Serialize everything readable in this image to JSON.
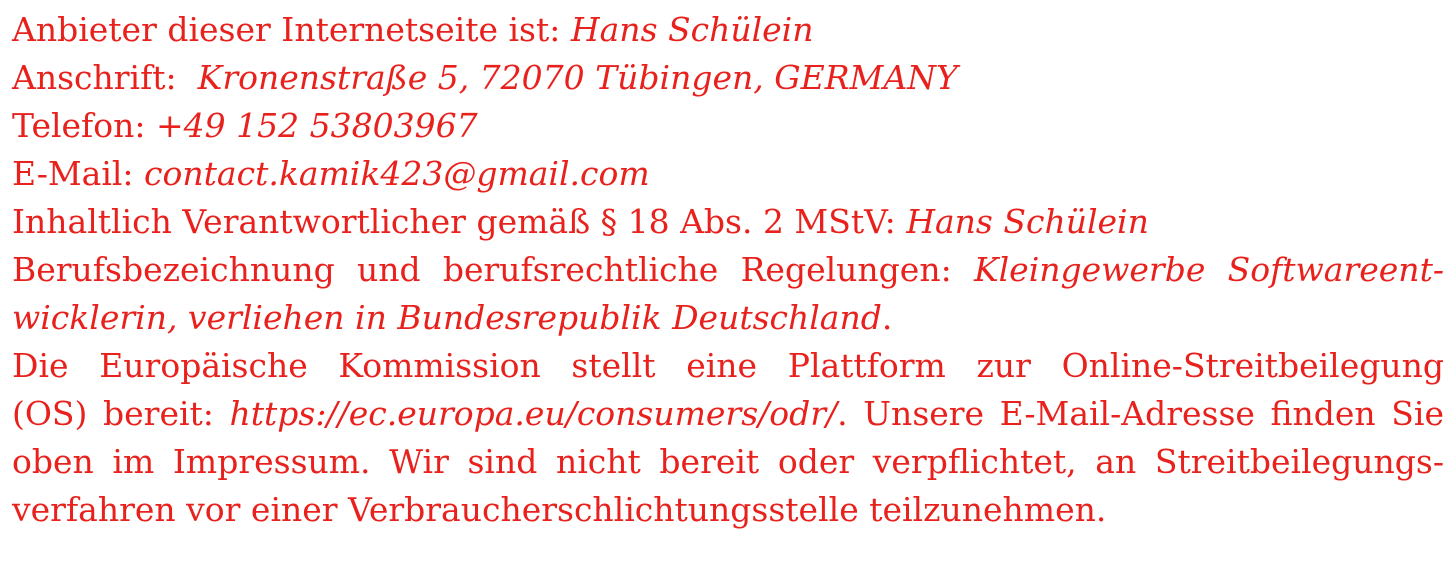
{
  "impressum": {
    "provider_label": "Anbieter dieser Internetseite ist:",
    "provider_name": "Hans Schülein",
    "address_label": "Anschrift:",
    "address_value": "Kronenstraße 5, 72070 Tübingen, GERMANY",
    "phone_label": "Telefon:",
    "phone_value": "+49 152 53803967",
    "email_label": "E-Mail:",
    "email_value": "contact.kamik423@gmail.com",
    "responsible_label": "Inhaltlich Verantwortlicher gemäß § 18 Abs. 2 MStV:",
    "responsible_name": "Hans Schülein",
    "profession_label": "Berufsbezeichnung und berufsrechtliche Regelungen:",
    "profession_value_part1": "Kleingewerbe Softwareent-",
    "profession_value_part2": "wicklerin, verliehen in Bundesrepublik Deutschland",
    "profession_value_end": ".",
    "odr_line1": "Die Europäische Kommission stellt eine Plattform zur Online-Streitbeilegung",
    "odr_prefix": "(OS) bereit:",
    "odr_link": "https://ec.europa.eu/consumers/odr/",
    "odr_suffix": ". Unsere E-Mail-Adresse finden Sie",
    "odr_line3": "oben im Impressum. Wir sind nicht bereit oder verpflichtet, an Streitbeilegungs-",
    "odr_line4": "verfahren vor einer Verbraucherschlichtungsstelle teilzunehmen."
  }
}
